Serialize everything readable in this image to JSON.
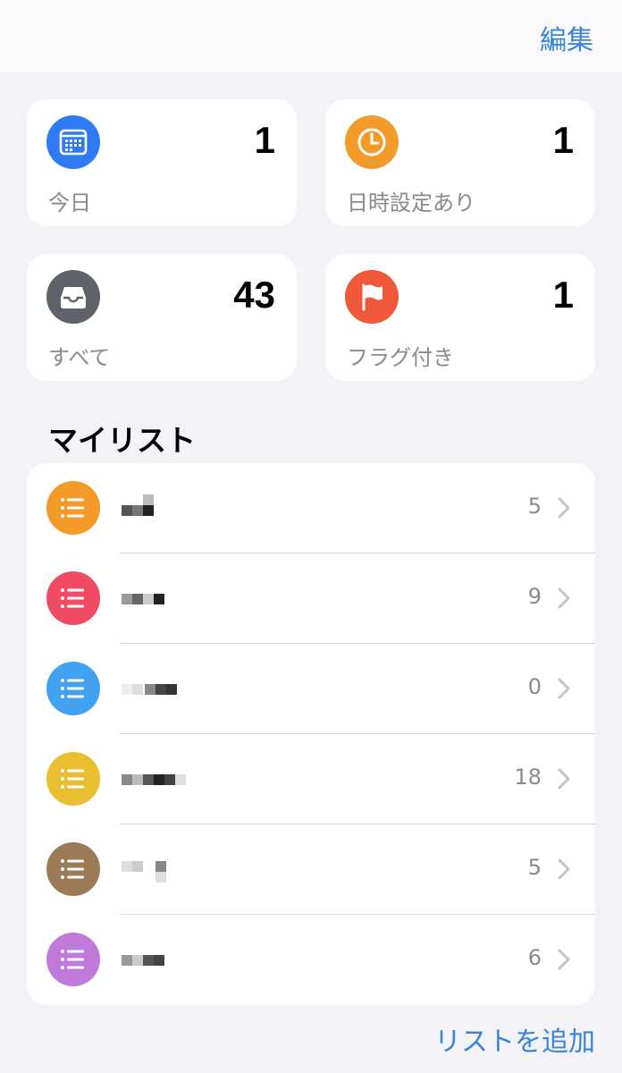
{
  "header": {
    "edit_label": "編集"
  },
  "smart_lists": {
    "today": {
      "label": "今日",
      "count": "1",
      "color": "#2f7bf5",
      "icon": "calendar-icon"
    },
    "scheduled": {
      "label": "日時設定あり",
      "count": "1",
      "color": "#f39a29",
      "icon": "clock-icon"
    },
    "all": {
      "label": "すべて",
      "count": "43",
      "color": "#5f6369",
      "icon": "tray-icon"
    },
    "flagged": {
      "label": "フラグ付き",
      "count": "1",
      "color": "#f0583a",
      "icon": "flag-icon"
    }
  },
  "my_lists": {
    "title": "マイリスト",
    "items": [
      {
        "count": "5",
        "color": "#f39a29",
        "icon": "list-bullet-icon"
      },
      {
        "count": "9",
        "color": "#f04b63",
        "icon": "list-bullet-icon"
      },
      {
        "count": "0",
        "color": "#42a2f2",
        "icon": "list-bullet-icon"
      },
      {
        "count": "18",
        "color": "#e9be2f",
        "icon": "list-bullet-icon"
      },
      {
        "count": "5",
        "color": "#9b7a55",
        "icon": "list-bullet-icon"
      },
      {
        "count": "6",
        "color": "#c07ad9",
        "icon": "list-bullet-icon"
      }
    ]
  },
  "footer": {
    "add_list_label": "リストを追加"
  }
}
